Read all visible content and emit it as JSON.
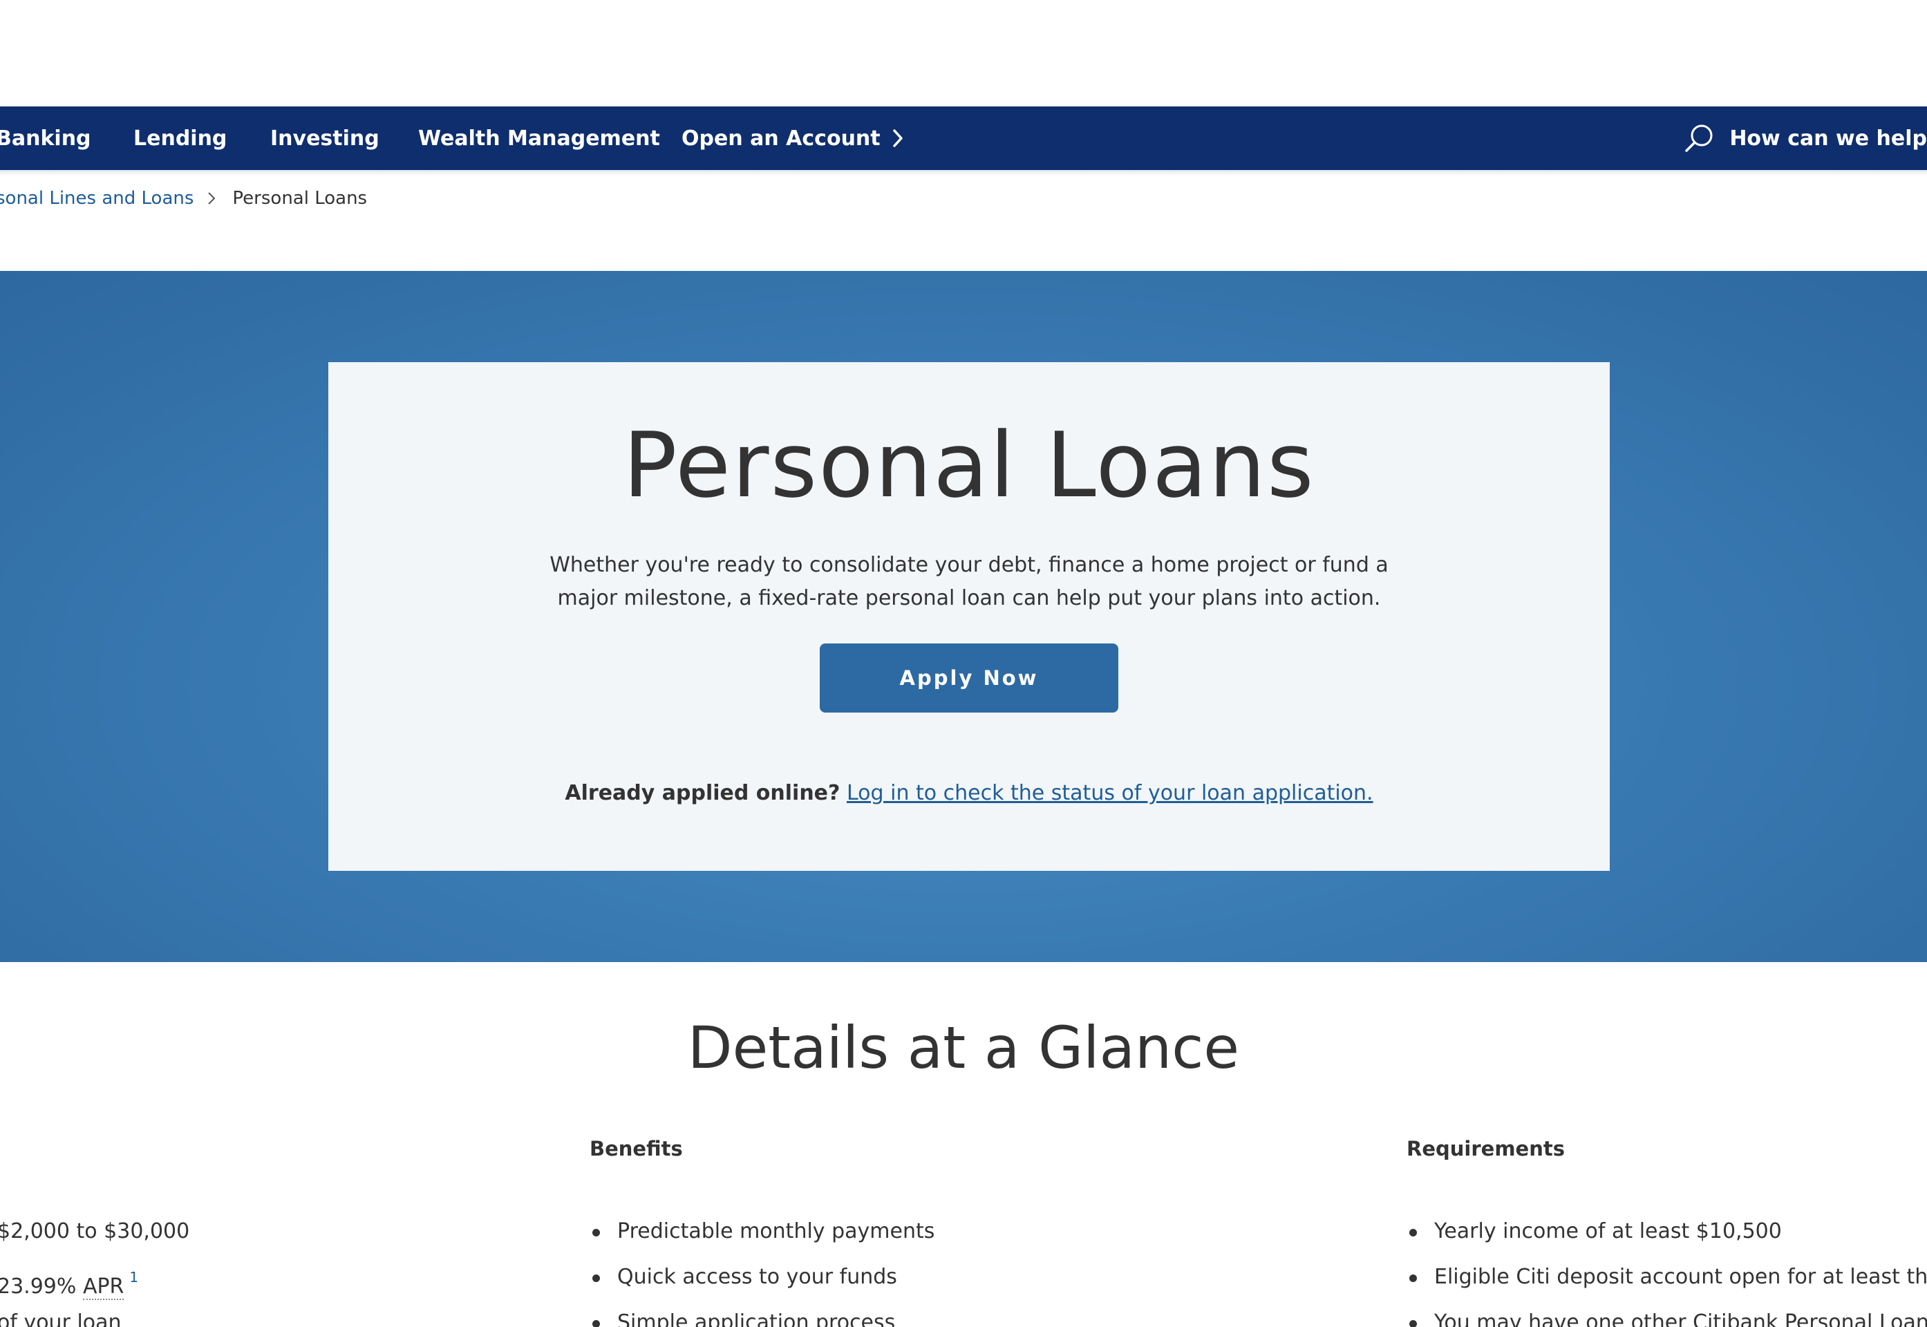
{
  "nav": {
    "items": [
      {
        "label": "Banking"
      },
      {
        "label": "Lending"
      },
      {
        "label": "Investing"
      },
      {
        "label": "Wealth Management"
      },
      {
        "label": "Open an Account"
      }
    ],
    "search_label": "How can we help"
  },
  "breadcrumb": {
    "parent": "sonal Lines and Loans",
    "current": "Personal Loans"
  },
  "hero": {
    "title": "Personal Loans",
    "description": "Whether you're ready to consolidate your debt, finance a home project or fund a major milestone, a fixed-rate personal loan can help put your plans into action.",
    "apply_label": "Apply Now",
    "status_prefix": "Already applied online?",
    "status_link": "Log in to check the status of your loan application."
  },
  "details": {
    "title": "Details at a Glance",
    "left_items": [
      {
        "text": "$2,000 to $30,000"
      },
      {
        "text": "23.99%",
        "abbr": "APR",
        "footnote": "1"
      },
      {
        "text": "of your loan"
      }
    ],
    "benefits": {
      "heading": "Benefits",
      "items": [
        "Predictable monthly payments",
        "Quick access to your funds",
        "Simple application process"
      ]
    },
    "requirements": {
      "heading": "Requirements",
      "items": [
        "Yearly income of at least $10,500",
        "Eligible Citi deposit account open for at least three",
        "You may have one other Citibank Personal Loan o"
      ]
    }
  },
  "colors": {
    "nav_bg": "#0f2e6e",
    "hero_bg": "#3a7bb3",
    "button_bg": "#2d6aa4",
    "link": "#1f5d97"
  }
}
